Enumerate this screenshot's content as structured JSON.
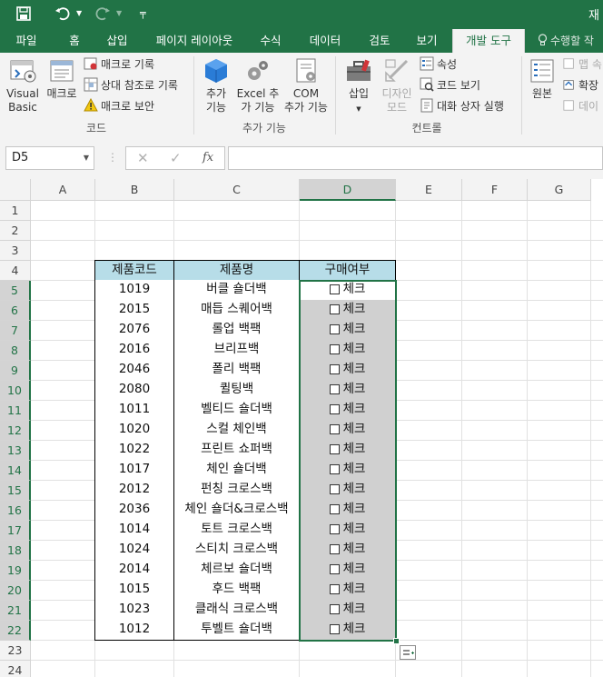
{
  "quick_access": {
    "save_icon": "save-icon",
    "undo_icon": "undo-icon",
    "redo_icon": "redo-icon",
    "customize_icon": "customize-icon"
  },
  "window": {
    "title_partial": "재"
  },
  "tabs": [
    {
      "label": "파일"
    },
    {
      "label": "홈"
    },
    {
      "label": "삽입"
    },
    {
      "label": "페이지 레이아웃"
    },
    {
      "label": "수식"
    },
    {
      "label": "데이터"
    },
    {
      "label": "검토"
    },
    {
      "label": "보기"
    },
    {
      "label": "개발 도구"
    }
  ],
  "tell_me": "수행할 작",
  "ribbon": {
    "code": {
      "label": "코드",
      "visual_basic_1": "Visual",
      "visual_basic_2": "Basic",
      "macro": "매크로",
      "record_macro": "매크로 기록",
      "relative_ref": "상대 참조로 기록",
      "macro_security": "매크로 보안"
    },
    "addins": {
      "label": "추가 기능",
      "addins_1": "추가",
      "addins_2": "기능",
      "excel_addins_1": "Excel 추",
      "excel_addins_2": "가 기능",
      "com_addins_1": "COM",
      "com_addins_2": "추가 기능"
    },
    "controls": {
      "label": "컨트롤",
      "insert": "삽입",
      "design_mode_1": "디자인",
      "design_mode_2": "모드",
      "properties": "속성",
      "view_code": "코드 보기",
      "run_dialog": "대화 상자 실행"
    },
    "xml": {
      "source": "원본",
      "map": "맵 속",
      "expand": "확장",
      "data": "데이"
    }
  },
  "formula_bar": {
    "name_box": "D5",
    "cancel_icon": "✕",
    "enter_icon": "✓",
    "fx": "fx",
    "content": ""
  },
  "columns": [
    "A",
    "B",
    "C",
    "D",
    "E",
    "F",
    "G"
  ],
  "rows": [
    "1",
    "2",
    "3",
    "4",
    "5",
    "6",
    "7",
    "8",
    "9",
    "10",
    "11",
    "12",
    "13",
    "14",
    "15",
    "16",
    "17",
    "18",
    "19",
    "20",
    "21",
    "22",
    "23",
    "24"
  ],
  "table": {
    "headers": [
      "제품코드",
      "제품명",
      "구매여부"
    ],
    "check_label": "체크",
    "rows": [
      {
        "code": "1019",
        "name": "버클 숄더백"
      },
      {
        "code": "2015",
        "name": "매듭 스퀘어백"
      },
      {
        "code": "2076",
        "name": "롤업 백팩"
      },
      {
        "code": "2016",
        "name": "브리프백"
      },
      {
        "code": "2046",
        "name": "폴리 백팩"
      },
      {
        "code": "2080",
        "name": "퀼팅백"
      },
      {
        "code": "1011",
        "name": "벨티드 숄더백"
      },
      {
        "code": "1020",
        "name": "스컬 체인백"
      },
      {
        "code": "1022",
        "name": "프린트 쇼퍼백"
      },
      {
        "code": "1017",
        "name": "체인 숄더백"
      },
      {
        "code": "2012",
        "name": "펀칭 크로스백"
      },
      {
        "code": "2036",
        "name": "체인 숄더&크로스백"
      },
      {
        "code": "1014",
        "name": "토트 크로스백"
      },
      {
        "code": "1024",
        "name": "스티치 크로스백"
      },
      {
        "code": "2014",
        "name": "체르보 숄더백"
      },
      {
        "code": "1015",
        "name": "후드 백팩"
      },
      {
        "code": "1023",
        "name": "클래식 크로스백"
      },
      {
        "code": "1012",
        "name": "투벨트 숄더백"
      }
    ]
  },
  "colors": {
    "excel_green": "#217346",
    "header_fill": "#b7dde8",
    "selected_fill": "#d0d0d0"
  }
}
